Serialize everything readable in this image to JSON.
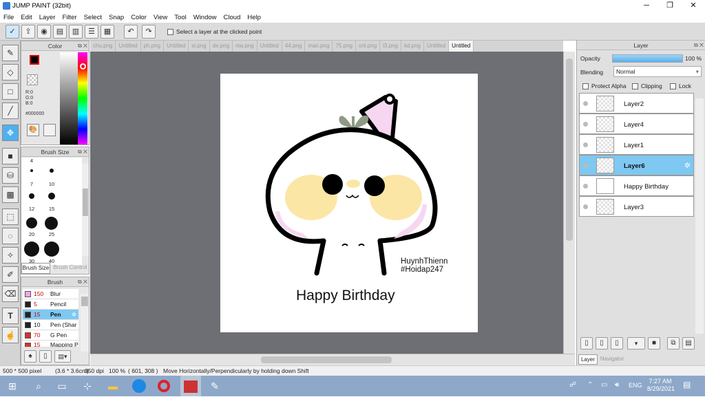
{
  "window": {
    "title": "JUMP PAINT (32bit)",
    "minimize": "─",
    "maximize": "❐",
    "close": "✕"
  },
  "menu": [
    "File",
    "Edit",
    "Layer",
    "Filter",
    "Select",
    "Snap",
    "Color",
    "View",
    "Tool",
    "Window",
    "Cloud",
    "Help"
  ],
  "toolbar": {
    "select_layer_label": "Select a layer at the clicked point"
  },
  "file_tabs": [
    "chu.png",
    "Untitled",
    "ph.png",
    "Untitled",
    "si.png",
    "de.png",
    "ma.png",
    "Untitled",
    "44.png",
    "man.png",
    "75.png",
    "onl.png",
    "l3.png",
    "kd.png",
    "Untitled",
    "Untitled"
  ],
  "active_tab_index": 15,
  "color_panel": {
    "title": "Color",
    "r": "R:0",
    "g": "G:0",
    "b": "B:0",
    "hex": "#000000",
    "current_color": "#000000"
  },
  "brush_size_panel": {
    "title": "Brush Size",
    "sizes": [
      "4",
      "7",
      "10",
      "12",
      "15",
      "20",
      "25",
      "30",
      "40"
    ],
    "tab_active": "Brush Size",
    "tab_inactive": "Brush Control"
  },
  "brush_panel": {
    "title": "Brush",
    "items": [
      {
        "size": "150",
        "name": "Blur",
        "color": "#f4a6e8"
      },
      {
        "size": "5",
        "name": "Pencil",
        "color": "#222222"
      },
      {
        "size": "15",
        "name": "Pen",
        "color": "#222222",
        "selected": true
      },
      {
        "size": "10",
        "name": "Pen (Shar",
        "color": "#222222"
      },
      {
        "size": "70",
        "name": "G Pen",
        "color": "#d83030"
      },
      {
        "size": "15",
        "name": "Mapping P",
        "color": "#d83030"
      }
    ]
  },
  "canvas_text": {
    "credit1": "HuynhThienn",
    "credit2": "#Hoidap247",
    "greeting": "Happy Birthday"
  },
  "layer_panel": {
    "title": "Layer",
    "opacity_label": "Opacity",
    "opacity_value": "100 %",
    "opacity": 1.0,
    "blending_label": "Blending",
    "blending_value": "Normal",
    "protect_alpha": "Protect Alpha",
    "clipping": "Clipping",
    "lock": "Lock",
    "layers": [
      "Layer2",
      "Layer4",
      "Layer1",
      "Layer6",
      "Happy Birthday",
      "Layer3"
    ],
    "selected_layer": "Layer6",
    "tab_layer": "Layer",
    "tab_navigator": "Navigator"
  },
  "status": {
    "size": "500 * 500 pixel",
    "dims": "(3.6 * 3.6cm)",
    "dpi": "350 dpi",
    "zoom": "100 %",
    "coords": "( 601, 308 )",
    "hint": "Move Horizontally/Perpendicularly by holding down Shift"
  },
  "taskbar": {
    "lang": "ENG",
    "time": "7:27 AM",
    "date": "8/29/2021"
  },
  "colors": {
    "selection": "#7ec8f2",
    "canvas_bg": "#6d6f74",
    "taskbar": "#8ea8c9"
  }
}
